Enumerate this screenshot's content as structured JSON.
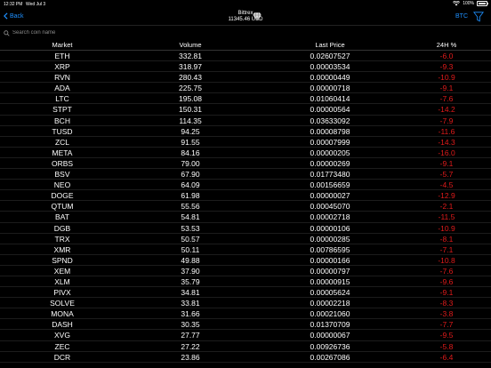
{
  "status_bar": {
    "time": "12:32 PM",
    "date": "Wed Jul 3",
    "battery": "100%"
  },
  "nav": {
    "back_label": "Back",
    "exchange": "Bittrex",
    "total": "11345.46 USD",
    "currency": "BTC"
  },
  "search": {
    "placeholder": "Search coin name"
  },
  "table": {
    "headers": {
      "market": "Market",
      "volume": "Volume",
      "last_price": "Last Price",
      "change": "24H %"
    },
    "rows": [
      {
        "market": "ETH",
        "volume": "332.81",
        "price": "0.02607527",
        "change": "-6.0"
      },
      {
        "market": "XRP",
        "volume": "318.97",
        "price": "0.00003534",
        "change": "-9.3"
      },
      {
        "market": "RVN",
        "volume": "280.43",
        "price": "0.00000449",
        "change": "-10.9"
      },
      {
        "market": "ADA",
        "volume": "225.75",
        "price": "0.00000718",
        "change": "-9.1"
      },
      {
        "market": "LTC",
        "volume": "195.08",
        "price": "0.01060414",
        "change": "-7.6"
      },
      {
        "market": "STPT",
        "volume": "150.31",
        "price": "0.00000564",
        "change": "-14.2"
      },
      {
        "market": "BCH",
        "volume": "114.35",
        "price": "0.03633092",
        "change": "-7.9"
      },
      {
        "market": "TUSD",
        "volume": "94.25",
        "price": "0.00008798",
        "change": "-11.6"
      },
      {
        "market": "ZCL",
        "volume": "91.55",
        "price": "0.00007999",
        "change": "-14.3"
      },
      {
        "market": "META",
        "volume": "84.16",
        "price": "0.00000205",
        "change": "-16.0"
      },
      {
        "market": "ORBS",
        "volume": "79.00",
        "price": "0.00000269",
        "change": "-9.1"
      },
      {
        "market": "BSV",
        "volume": "67.90",
        "price": "0.01773480",
        "change": "-5.7"
      },
      {
        "market": "NEO",
        "volume": "64.09",
        "price": "0.00156659",
        "change": "-4.5"
      },
      {
        "market": "DOGE",
        "volume": "61.98",
        "price": "0.00000027",
        "change": "-12.9"
      },
      {
        "market": "QTUM",
        "volume": "55.56",
        "price": "0.00045070",
        "change": "-2.1"
      },
      {
        "market": "BAT",
        "volume": "54.81",
        "price": "0.00002718",
        "change": "-11.5"
      },
      {
        "market": "DGB",
        "volume": "53.53",
        "price": "0.00000106",
        "change": "-10.9"
      },
      {
        "market": "TRX",
        "volume": "50.57",
        "price": "0.00000285",
        "change": "-8.1"
      },
      {
        "market": "XMR",
        "volume": "50.11",
        "price": "0.00786595",
        "change": "-7.1"
      },
      {
        "market": "SPND",
        "volume": "49.88",
        "price": "0.00000166",
        "change": "-10.8"
      },
      {
        "market": "XEM",
        "volume": "37.90",
        "price": "0.00000797",
        "change": "-7.6"
      },
      {
        "market": "XLM",
        "volume": "35.79",
        "price": "0.00000915",
        "change": "-9.6"
      },
      {
        "market": "PIVX",
        "volume": "34.81",
        "price": "0.00005624",
        "change": "-9.1"
      },
      {
        "market": "SOLVE",
        "volume": "33.81",
        "price": "0.00002218",
        "change": "-8.3"
      },
      {
        "market": "MONA",
        "volume": "31.66",
        "price": "0.00021060",
        "change": "-3.8"
      },
      {
        "market": "DASH",
        "volume": "30.35",
        "price": "0.01370709",
        "change": "-7.7"
      },
      {
        "market": "XVG",
        "volume": "27.77",
        "price": "0.00000067",
        "change": "-9.5"
      },
      {
        "market": "ZEC",
        "volume": "27.22",
        "price": "0.00926736",
        "change": "-5.8"
      },
      {
        "market": "DCR",
        "volume": "23.86",
        "price": "0.00267086",
        "change": "-6.4"
      }
    ]
  }
}
